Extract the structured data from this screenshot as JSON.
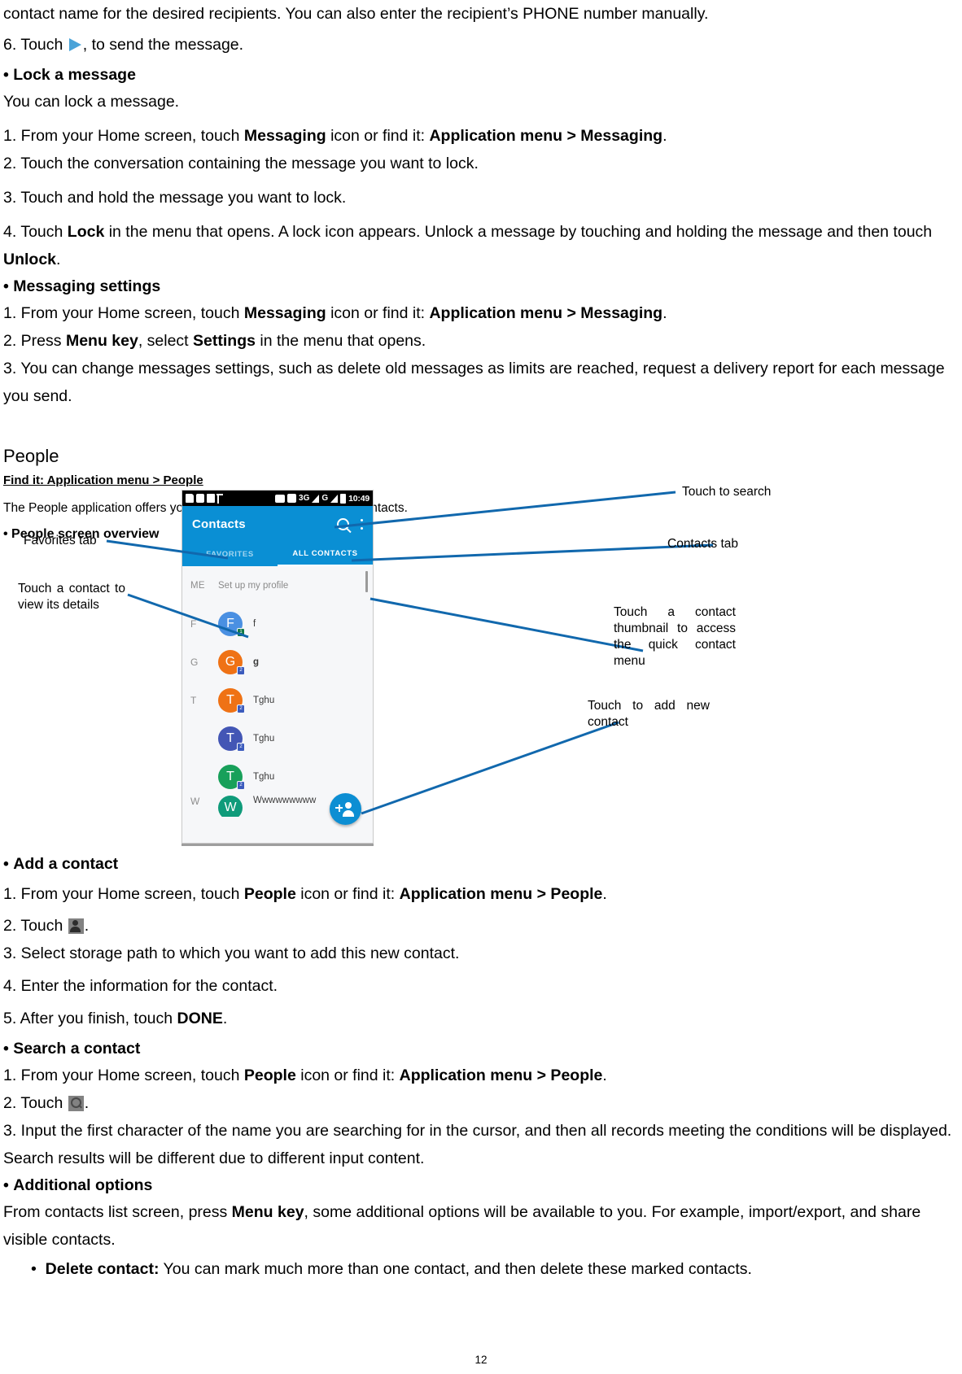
{
  "document": {
    "page_number": "12",
    "top_paragraphs": [
      "contact name for the desired recipients. You can also enter the recipient’s PHONE number manually.",
      "6. Touch ▶, to send the message."
    ],
    "line1": "contact name for the desired recipients. You can also enter the recipient’s PHONE number manually.",
    "step6_prefix": "6. Touch ",
    "step6_suffix": ", to send the message.",
    "lock_heading": "Lock a message",
    "lock_intro": "You can lock a message.",
    "lock_steps": {
      "s1_a": "1. From your Home screen, touch ",
      "s1_b": "Messaging",
      "s1_c": " icon or find it: ",
      "s1_d": "Application menu > Messaging",
      "s1_e": ".",
      "s2": "2. Touch the conversation containing the message you want to lock.",
      "s3": "3. Touch and hold the message you want to lock.",
      "s4_a": "4. Touch ",
      "s4_b": "Lock",
      "s4_c": " in the menu that opens. A lock icon appears. Unlock a message by touching and holding the message and then touch ",
      "s4_d": "Unlock",
      "s4_e": "."
    },
    "settings_heading": "Messaging settings",
    "settings_steps": {
      "s1_a": "1. From your Home screen, touch ",
      "s1_b": "Messaging",
      "s1_c": " icon or find it: ",
      "s1_d": "Application menu > Messaging",
      "s1_e": ".",
      "s2_a": "2. Press ",
      "s2_b": "Menu key",
      "s2_c": ", select ",
      "s2_d": "Settings",
      "s2_e": " in the menu that opens.",
      "s3": "3. You can change messages settings, such as delete old messages as limits are reached, request a delivery report for each message you send."
    },
    "people_section": {
      "title": "People",
      "find_it": "Find it: Application menu > People",
      "intro": "The People application offers you to store and manage all your contacts.",
      "overview_heading": "People screen overview"
    },
    "add_contact": {
      "heading": "Add a contact",
      "s1_a": "1. From your Home screen, touch ",
      "s1_b": "People",
      "s1_c": " icon or find it: ",
      "s1_d": "Application menu > People",
      "s1_e": ".",
      "s2_a": "2. Touch ",
      "s2_b": ".",
      "s3": "3. Select storage path to which you want to add this new contact.",
      "s4": "4. Enter the information for the contact.",
      "s5_a": "5. After you finish, touch ",
      "s5_b": "DONE",
      "s5_c": "."
    },
    "search_contact": {
      "heading": "Search a contact",
      "s1_a": "1. From your Home screen, touch ",
      "s1_b": "People",
      "s1_c": " icon or find it: ",
      "s1_d": "Application menu > People",
      "s1_e": ".",
      "s2_a": "2. Touch ",
      "s2_b": ".",
      "s3": "3. Input the first character of the name you are searching for in the cursor, and then all records meeting the conditions will be displayed. Search results will be different due to different input content."
    },
    "additional_options": {
      "heading": "Additional options",
      "intro_a": "From contacts list screen, press ",
      "intro_b": "Menu key",
      "intro_c": ", some additional options will be available to you. For example, import/export, and share visible contacts.",
      "bullet_label": "Delete contact:",
      "bullet_text": " You can mark much more than one contact, and then delete these marked contacts."
    }
  },
  "figure": {
    "callouts": {
      "favorites_tab": "Favorites tab",
      "touch_contact_details": "Touch a contact to view its details",
      "touch_to_search": "Touch to search",
      "contacts_tab": "Contacts tab",
      "thumbnail_quick_menu": "Touch a contact thumbnail to access the quick contact menu",
      "add_new_contact": "Touch to add new contact"
    },
    "phone": {
      "status_bar": {
        "network": "3G",
        "network2": "G",
        "time": "10:49"
      },
      "app_title": "Contacts",
      "tabs": [
        {
          "label": "FAVORITES",
          "active": false
        },
        {
          "label": "ALL CONTACTS",
          "active": true
        }
      ],
      "me_label": "ME",
      "me_value": "Set up my profile",
      "contacts": [
        {
          "letter": "F",
          "initial": "F",
          "name": "f",
          "color": "#4a90e2",
          "sim": "1",
          "sim_color": "#127a47"
        },
        {
          "letter": "G",
          "initial": "G",
          "name": "g",
          "color": "#ef7215",
          "sim": "2",
          "sim_color": "#3b5bbd"
        },
        {
          "letter": "T",
          "initial": "T",
          "name": "Tghu",
          "color": "#ef7215",
          "sim": "2",
          "sim_color": "#3b5bbd"
        },
        {
          "letter": "",
          "initial": "T",
          "name": "Tghu",
          "color": "#4356b5",
          "sim": "2",
          "sim_color": "#3b5bbd"
        },
        {
          "letter": "",
          "initial": "T",
          "name": "Tghu",
          "color": "#18a05a",
          "sim": "2",
          "sim_color": "#3b5bbd"
        },
        {
          "letter": "W",
          "initial": "W",
          "name": "Wwwwwwwww",
          "color": "#0f9b7a",
          "sim": "",
          "sim_color": "#3b5bbd"
        }
      ]
    },
    "colors": {
      "accent": "#0a8fd4",
      "leader": "#1168ad",
      "status_bar": "#000000",
      "list_bg": "#f6f7f9"
    }
  }
}
